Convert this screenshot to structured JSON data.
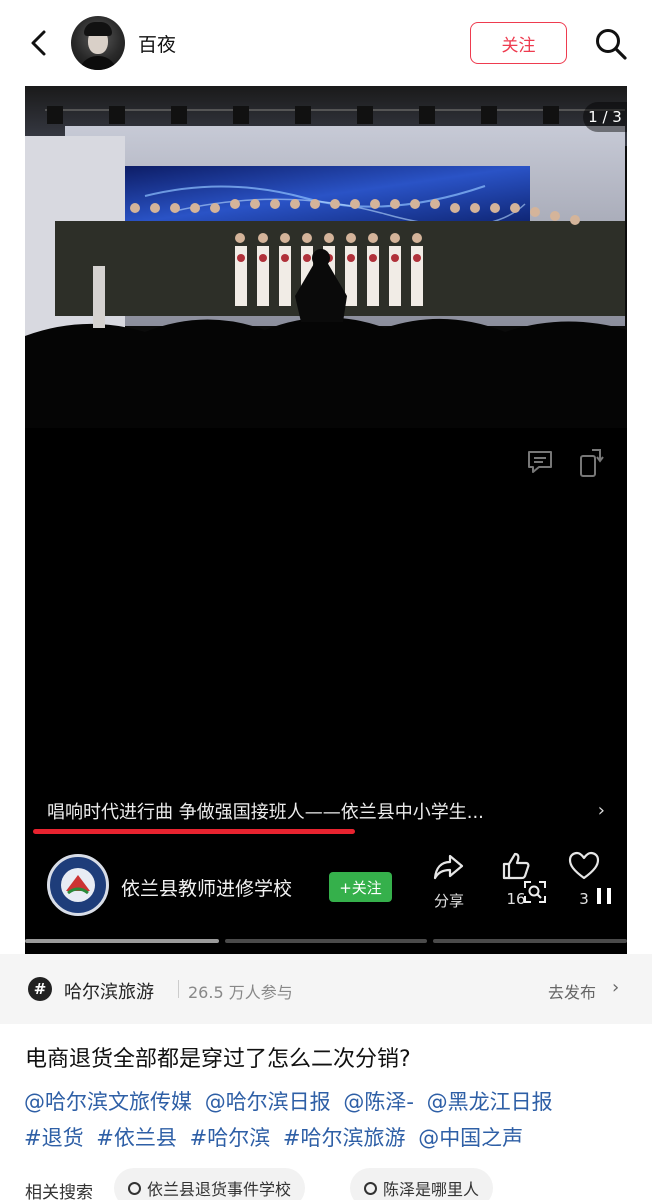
{
  "header": {
    "username": "百夜",
    "follow_label": "关注"
  },
  "media": {
    "page_counter": "1 / 3",
    "caption": "唱响时代进行曲 争做强国接班人——依兰县中小学生...",
    "author_name": "依兰县教师进修学校",
    "author_follow_label": "+关注",
    "share_label": "分享",
    "like_count": "16",
    "favorite_count": "3",
    "progress_fraction": 0.5,
    "current_page": 1,
    "total_pages": 3
  },
  "topic": {
    "name": "哈尔滨旅游",
    "participants": "26.5 万人参与",
    "action_label": "去发布"
  },
  "post": {
    "title": "电商退货全部都是穿过了怎么二次分销?",
    "tags": [
      "@哈尔滨文旅传媒",
      "@哈尔滨日报",
      "@陈泽-",
      "@黑龙江日报",
      "#退货",
      "#依兰县",
      "#哈尔滨",
      "#哈尔滨旅游",
      "@中国之声"
    ]
  },
  "related": {
    "label": "相关搜索",
    "items": [
      "依兰县退货事件学校",
      "陈泽是哪里人"
    ]
  },
  "colors": {
    "accent_red": "#ee3b4f",
    "follow_green": "#35b04b",
    "link_blue": "#2e5fa6"
  }
}
